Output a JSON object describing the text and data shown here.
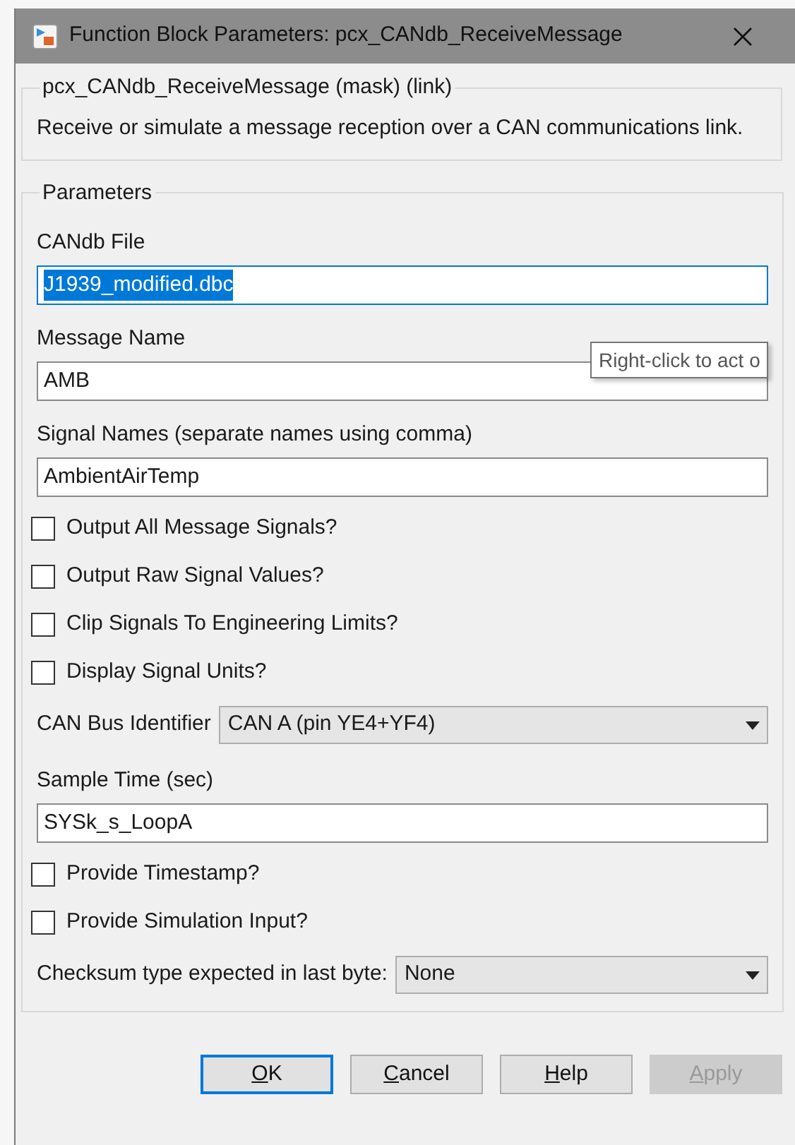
{
  "window": {
    "title": "Function Block Parameters: pcx_CANdb_ReceiveMessage"
  },
  "mask": {
    "title": "pcx_CANdb_ReceiveMessage (mask) (link)",
    "description": "Receive or simulate a message reception over a CAN communications link."
  },
  "parameters": {
    "title": "Parameters",
    "items": [
      {
        "kind": "field",
        "label": "CANdb File",
        "value": "J1939_modified.dbc",
        "text_selected": true
      },
      {
        "kind": "field",
        "label": "Message Name",
        "value": "AMB",
        "text_selected": false,
        "tooltip": "Right-click to act o"
      },
      {
        "kind": "field",
        "label": "Signal Names (separate names using comma)",
        "value": "AmbientAirTemp",
        "text_selected": false
      },
      {
        "kind": "checkbox",
        "label": "Output All Message Signals?",
        "checked": false
      },
      {
        "kind": "checkbox",
        "label": "Output Raw Signal Values?",
        "checked": false
      },
      {
        "kind": "checkbox",
        "label": "Clip Signals To Engineering Limits?",
        "checked": false
      },
      {
        "kind": "checkbox",
        "label": "Display Signal Units?",
        "checked": false
      },
      {
        "kind": "dropdown",
        "label": "CAN Bus Identifier",
        "value": "CAN A (pin YE4+YF4)"
      },
      {
        "kind": "field",
        "label": "Sample Time (sec)",
        "value": "SYSk_s_LoopA",
        "text_selected": false
      },
      {
        "kind": "checkbox",
        "label": "Provide Timestamp?",
        "checked": false
      },
      {
        "kind": "checkbox",
        "label": "Provide Simulation Input?",
        "checked": false
      },
      {
        "kind": "dropdown",
        "label": "Checksum type expected in last byte:",
        "value": "None"
      }
    ]
  },
  "buttons": [
    {
      "label": "OK",
      "focused": true,
      "disabled": false
    },
    {
      "label": "Cancel",
      "focused": false,
      "disabled": false
    },
    {
      "label": "Help",
      "focused": false,
      "disabled": false
    },
    {
      "label": "Apply",
      "focused": false,
      "disabled": true
    }
  ]
}
